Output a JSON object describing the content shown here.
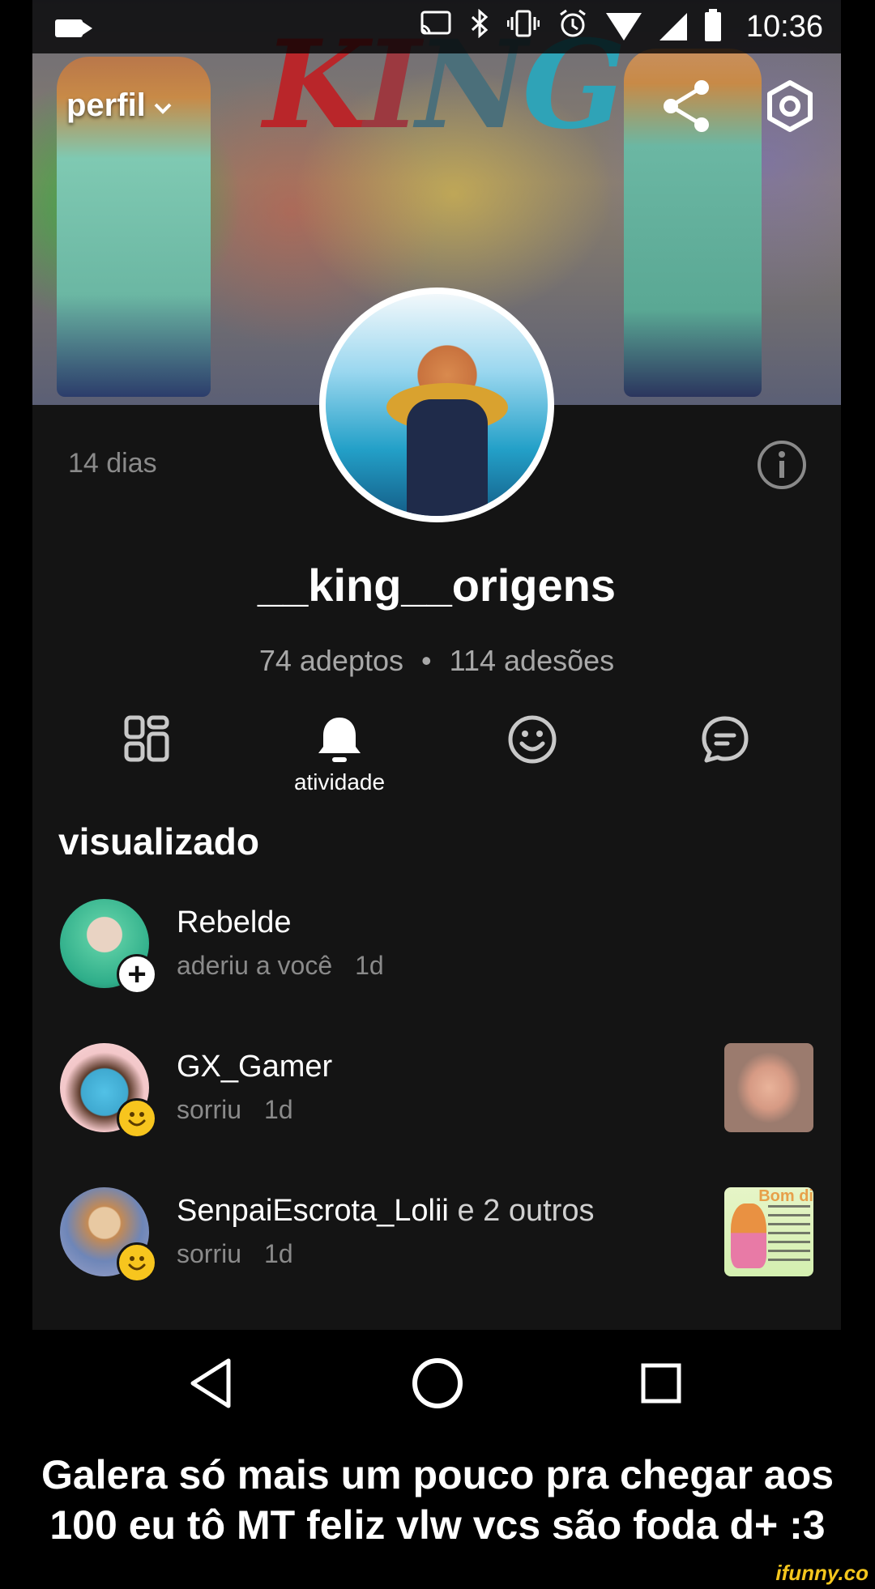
{
  "status_bar": {
    "time": "10:36",
    "icons": [
      "video-icon",
      "cast-icon",
      "bluetooth-icon",
      "vibrate-icon",
      "alarm-icon",
      "wifi-icon",
      "signal-icon",
      "battery-icon"
    ]
  },
  "header": {
    "title": "perfil",
    "banner_text": [
      "K",
      "I",
      "N",
      "G"
    ],
    "share_icon": "share-icon",
    "settings_icon": "settings-icon"
  },
  "profile": {
    "days": "14 dias",
    "username": "__king__origens",
    "followers": "74 adeptos",
    "separator": "•",
    "following": "114 adesões"
  },
  "tabs": [
    {
      "icon": "grid-icon",
      "label": ""
    },
    {
      "icon": "bell-icon",
      "label": "atividade"
    },
    {
      "icon": "smile-icon",
      "label": ""
    },
    {
      "icon": "chat-icon",
      "label": ""
    }
  ],
  "section_title": "visualizado",
  "activity": [
    {
      "name": "Rebelde",
      "extra": "",
      "action": "aderiu a você",
      "time": "1d",
      "badge": "plus-icon"
    },
    {
      "name": "GX_Gamer",
      "extra": "",
      "action": "sorriu",
      "time": "1d",
      "badge": "smile-icon"
    },
    {
      "name": "SenpaiEscrota_Lolii",
      "extra": "e 2 outros",
      "action": "sorriu",
      "time": "1d",
      "badge": "smile-icon",
      "thumb_text": "Bom di"
    }
  ],
  "nav": [
    "back-icon",
    "home-icon",
    "recents-icon"
  ],
  "caption": [
    "Galera só mais um pouco pra chegar aos",
    "100 eu tô MT feliz vlw vcs são foda d+ :3"
  ],
  "watermark": "ifunny.co",
  "colors": {
    "background": "#141414",
    "muted_text": "#8a8a8a",
    "badge_yellow": "#f7c51e",
    "watermark": "#f4c61d"
  }
}
